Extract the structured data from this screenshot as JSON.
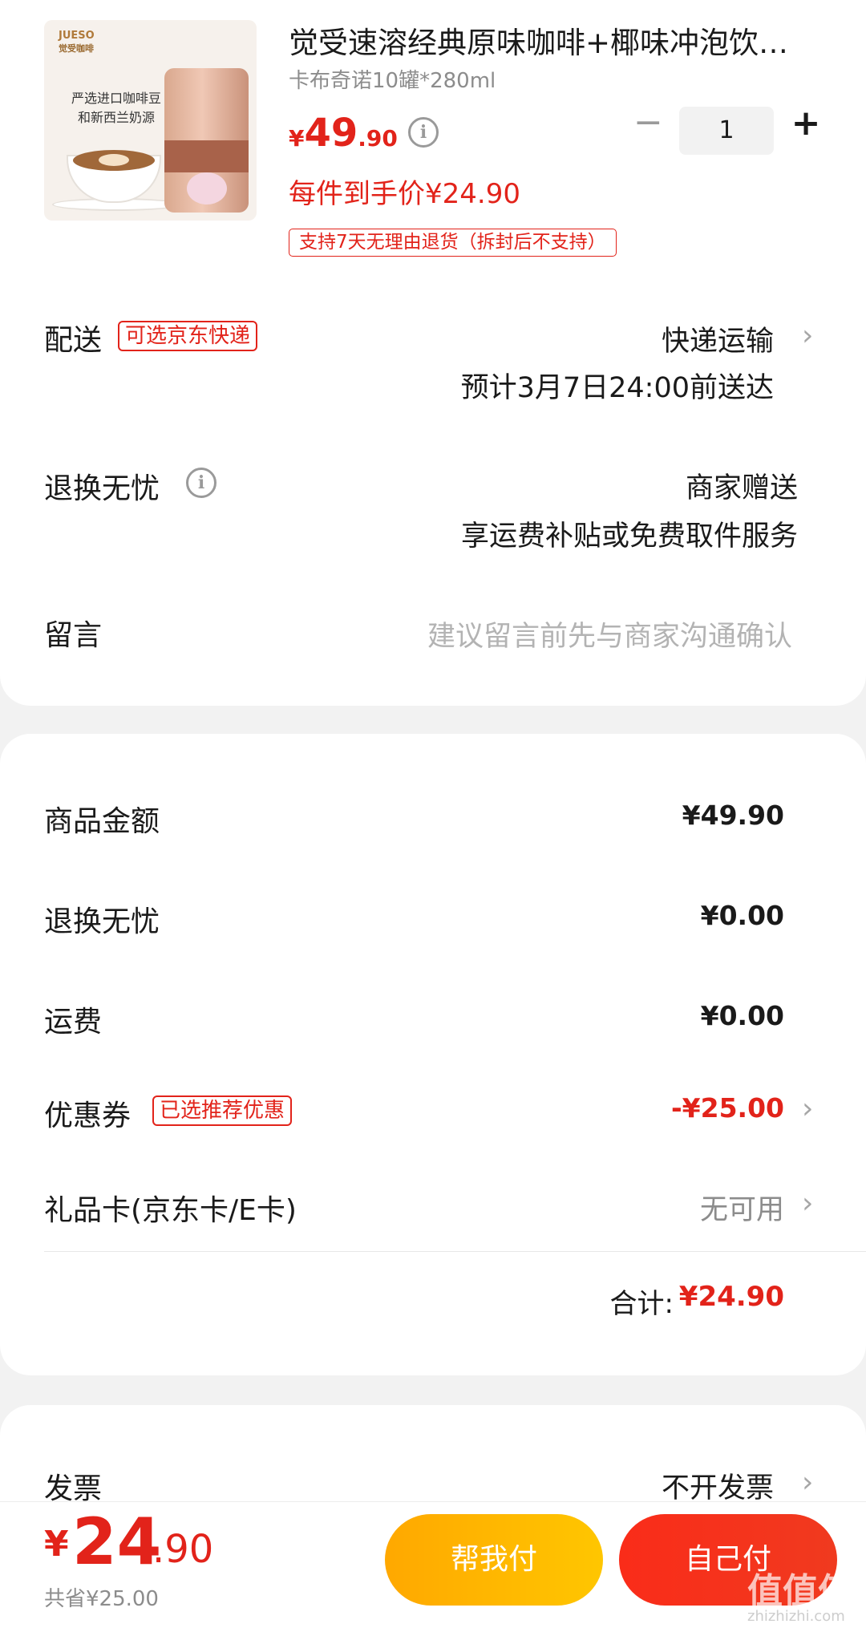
{
  "product": {
    "title": "觉受速溶经典原味咖啡+椰味冲泡饮…",
    "spec": "卡布奇诺10罐*280ml",
    "price_symbol": "¥",
    "price_int": "49",
    "price_dec": ".90",
    "quantity": "1",
    "hand_price": "每件到手价¥24.90",
    "return_tag": "支持7天无理由退货（拆封后不支持）",
    "image": {
      "brand": "JUESO",
      "brand_cn": "觉受咖啡",
      "caption_line1": "严选进口咖啡豆",
      "caption_line2": "和新西兰奶源"
    }
  },
  "delivery": {
    "label": "配送",
    "tag": "可选京东快递",
    "method": "快递运输",
    "eta": "预计3月7日24:00前送达"
  },
  "worry_free": {
    "label": "退换无忧",
    "line1": "商家赠送",
    "line2": "享运费补贴或免费取件服务"
  },
  "note": {
    "label": "留言",
    "placeholder": "建议留言前先与商家沟通确认"
  },
  "summary": {
    "goods_label": "商品金额",
    "goods_value": "¥49.90",
    "worry_label": "退换无忧",
    "worry_value": "¥0.00",
    "shipping_label": "运费",
    "shipping_value": "¥0.00",
    "coupon_label": "优惠券",
    "coupon_tag": "已选推荐优惠",
    "coupon_value": "-¥25.00",
    "giftcard_label": "礼品卡(京东卡/E卡)",
    "giftcard_value": "无可用",
    "total_label": "合计:",
    "total_value": "¥24.90"
  },
  "invoice": {
    "label": "发票",
    "value": "不开发票"
  },
  "bottom": {
    "pay_symbol": "¥",
    "pay_int": "24",
    "pay_dec": ".90",
    "saved": "共省¥25.00",
    "help_pay": "帮我付",
    "self_pay": "自己付"
  },
  "watermark": {
    "text": "值值值",
    "sub": "zhizhizhi.com"
  },
  "colors": {
    "accent_red": "#e2231a",
    "button_orange": "#ffb400",
    "button_red": "#f5301c"
  },
  "icons": [
    "info-icon",
    "minus-icon",
    "plus-icon",
    "chevron-right-icon"
  ]
}
